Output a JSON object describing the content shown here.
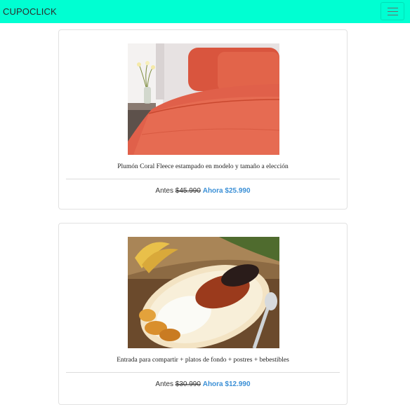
{
  "navbar": {
    "brand": "CUPOCLICK",
    "background": "#00ffd2"
  },
  "products": [
    {
      "image_icon": "bedding-photo",
      "title": "Plumón Coral Fleece estampado en modelo y tamaño a elección",
      "before_label": "Antes",
      "old_price": "$45.990",
      "now_label": "Ahora",
      "new_price": "$25.990"
    },
    {
      "image_icon": "food-plate-photo",
      "title": "Entrada para compartir + platos de fondo + postres + bebestibles",
      "before_label": "Antes",
      "old_price": "$30.990",
      "now_label": "Ahora",
      "new_price": "$12.990"
    }
  ],
  "colors": {
    "accent_price": "#3a8fd6"
  }
}
